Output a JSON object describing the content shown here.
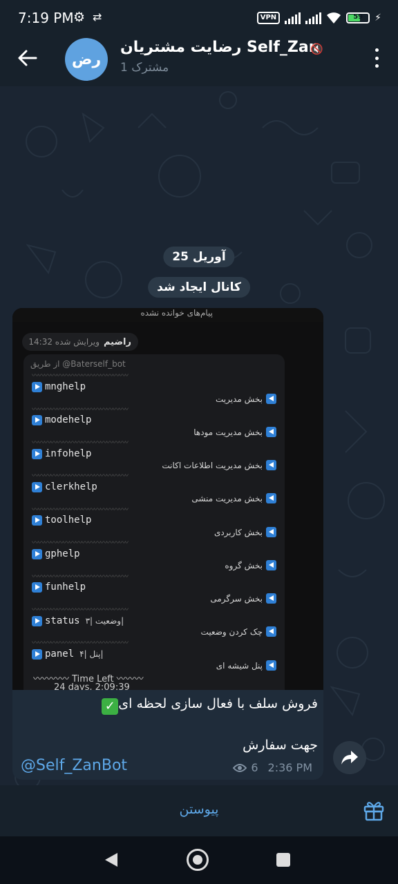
{
  "status_bar": {
    "time": "7:19 PM",
    "vpn": "VPN",
    "battery": "59"
  },
  "header": {
    "avatar_text": "رض",
    "title": "رضایت مشتریان Self_Zan",
    "subscribers": "1 مشترک"
  },
  "chat": {
    "date_pill": "25 آوریل",
    "service_pill": "کانال ایجاد شد",
    "message": {
      "screenshot": {
        "top_text": "پیام‌های خوانده نشده",
        "edited_label": "ویرایش شده 14:32",
        "sender": "راضیم",
        "via": "از طریق @Baterself_bot",
        "commands": [
          "mnghelp",
          "modehelp",
          "infohelp",
          "clerkhelp",
          "toolhelp",
          "gphelp",
          "funhelp",
          "status",
          "panel"
        ],
        "command_suffix_status": "وضعیت |۳|",
        "command_suffix_panel": "پنل |۴|",
        "sections": [
          "بخش مدیریت",
          "بخش مدیریت مودها",
          "بخش مدیریت اطلاعات اکانت",
          "بخش مدیریت منشی",
          "بخش کاربردی",
          "بخش گروه",
          "بخش سرگرمی",
          "چک کردن وضعیت",
          "پنل شیشه ای"
        ],
        "time_left": "Time Left",
        "days": "24 days, 2:09:39"
      },
      "caption_line1": "فروش سلف با فعال سازی لحظه ای",
      "caption_line2": "جهت سفارش",
      "bot_link": "@Self_ZanBot",
      "views": "6",
      "time": "2:36 PM"
    }
  },
  "join_bar": {
    "label": "پیوستن"
  },
  "colors": {
    "accent": "#5ea8e8",
    "header_bg": "#17212b",
    "chat_bg": "#1b2532",
    "bubble_bg": "#1f2c3a"
  }
}
